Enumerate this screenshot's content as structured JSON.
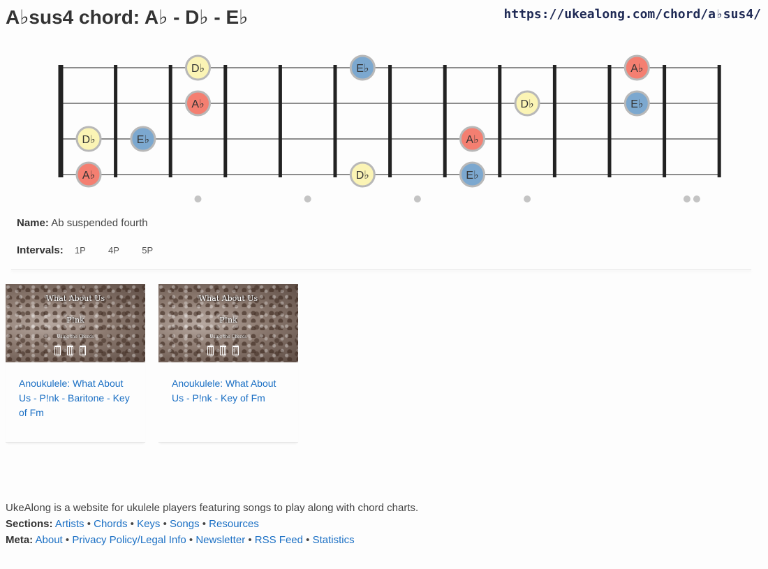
{
  "header": {
    "title": "A♭sus4 chord: A♭ - D♭ - E♭",
    "url": "https://ukealong.com/chord/a♭sus4/"
  },
  "colors": {
    "Ab": "#f47f71",
    "Db": "#fbf4b5",
    "Eb": "#7ca8cf",
    "note_border": "#b8b8b8",
    "fret": "#222222",
    "string": "#666666",
    "marker": "#c4c4c4",
    "link": "#1a6fc4"
  },
  "fretboard": {
    "fret_count": 12,
    "marker_frets": [
      3,
      5,
      7,
      9
    ],
    "double_marker_frets": [
      12
    ],
    "notes": [
      {
        "string": 1,
        "fret": 3,
        "label": "D♭",
        "note": "Db"
      },
      {
        "string": 1,
        "fret": 6,
        "label": "E♭",
        "note": "Eb"
      },
      {
        "string": 1,
        "fret": 11,
        "label": "A♭",
        "note": "Ab"
      },
      {
        "string": 2,
        "fret": 3,
        "label": "A♭",
        "note": "Ab"
      },
      {
        "string": 2,
        "fret": 9,
        "label": "D♭",
        "note": "Db"
      },
      {
        "string": 2,
        "fret": 11,
        "label": "E♭",
        "note": "Eb"
      },
      {
        "string": 3,
        "fret": 0,
        "label": "D♭",
        "note": "Db"
      },
      {
        "string": 3,
        "fret": 2,
        "label": "E♭",
        "note": "Eb"
      },
      {
        "string": 3,
        "fret": 8,
        "label": "A♭",
        "note": "Ab"
      },
      {
        "string": 4,
        "fret": 0,
        "label": "A♭",
        "note": "Ab"
      },
      {
        "string": 4,
        "fret": 6,
        "label": "D♭",
        "note": "Db"
      },
      {
        "string": 4,
        "fret": 8,
        "label": "E♭",
        "note": "Eb"
      }
    ]
  },
  "info": {
    "name_label": "Name:",
    "name_value": "Ab suspended fourth",
    "intervals_label": "Intervals:",
    "intervals": [
      "1P",
      "4P",
      "5P"
    ]
  },
  "videos": [
    {
      "thumb_title": "What About Us",
      "thumb_artist": "P!nk",
      "thumb_sub": "Using the Chords",
      "link": "Anoukulele: What About Us - P!nk - Baritone - Key of Fm"
    },
    {
      "thumb_title": "What About Us",
      "thumb_artist": "P!nk",
      "thumb_sub": "Using the Chords",
      "link": "Anoukulele: What About Us - P!nk - Key of Fm"
    }
  ],
  "footer": {
    "about_text": "UkeAlong is a website for ukulele players featuring songs to play along with chord charts.",
    "sections_label": "Sections:",
    "sections": [
      "Artists",
      "Chords",
      "Keys",
      "Songs",
      "Resources"
    ],
    "meta_label": "Meta:",
    "meta": [
      "About",
      "Privacy Policy/Legal Info",
      "Newsletter",
      "RSS Feed",
      "Statistics"
    ],
    "separator": " • "
  }
}
